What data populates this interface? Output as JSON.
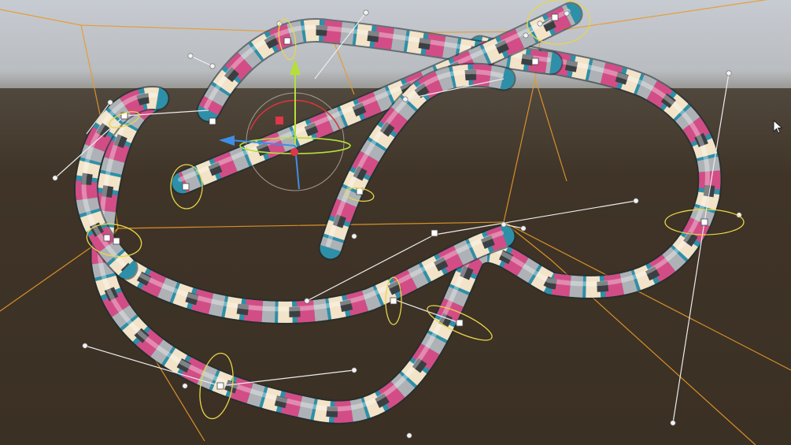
{
  "scene": {
    "type": "3d-spline-tube-editor-viewport",
    "sky_color": "#c9cdd3",
    "ground_color": "#3e3326",
    "tube_palette": [
      "#2e8fa8",
      "#d24d86",
      "#f3e3c8",
      "#aeb2b6",
      "#3c3f42",
      "#69c6cc",
      "#f2b7b1"
    ],
    "spline_cage_color": "#e89a2a",
    "handle_line_color": "#ededed",
    "rotation_ring_color": "#e7d64a"
  },
  "gizmo": {
    "axis_x_color": "#3f8ee6",
    "axis_y_color": "#b5e03a",
    "axis_z_color": "#3f8ee6",
    "ring_color": "#d7353c",
    "center_color": "#e0354a"
  },
  "cursor": {
    "icon": "arrow-cursor-icon"
  }
}
